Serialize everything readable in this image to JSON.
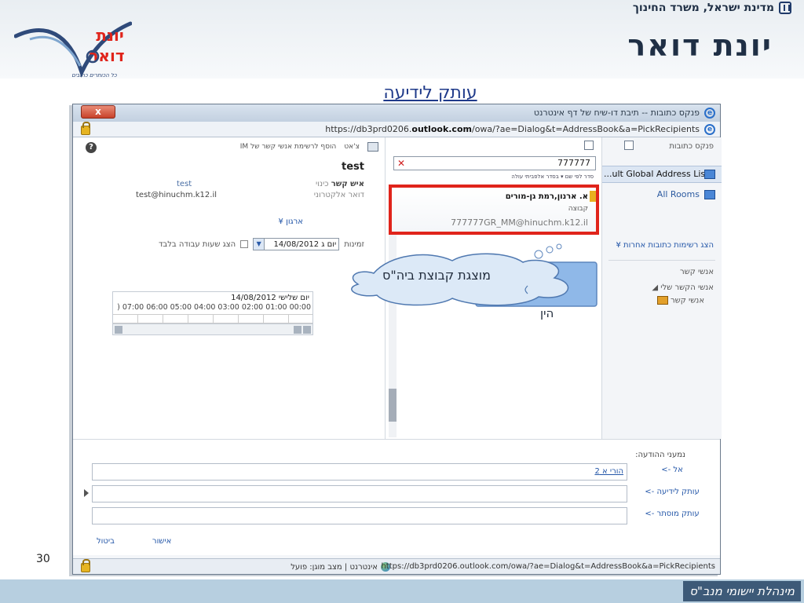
{
  "slide": {
    "ministry": "מדינת ישראל, משרד החינוך",
    "main_title": "יונת דואר",
    "logo_text_top": "יונת",
    "logo_text_bottom": "דואר",
    "logo_tagline": "כל הכותרים כתובים",
    "slide_title": "עותק לידיעה",
    "page_number": "30",
    "footer_tag": "מינהלת יישומי מנב\"ס"
  },
  "browser": {
    "close_label": "x",
    "window_title": "פנקס כתובות -- תיבת דו-שיח של דף אינטרנט",
    "address_prefix": "https://db3prd0206.",
    "address_domain": "outlook.com",
    "address_suffix": "/owa/?ae=Dialog&t=AddressBook&a=PickRecipients",
    "status_url": "https://db3prd0206.outlook.com/owa/?ae=Dialog&t=AddressBook&a=PickRecipients",
    "status_zone": "אינטרנט | מצב מוגן: פועל"
  },
  "left_pane": {
    "chat_label": "צ'אט",
    "add_to_im": "הוסף לרשימת אנשי קשר של IM",
    "contact_name": "test",
    "contact_label": "איש קשר",
    "alias_label": "כינוי",
    "alias_value": "test",
    "email_label": "דואר אלקטרוני",
    "email_value": "test@hinuchm.k12.il",
    "organization_link": "ארגון",
    "availability_label": "זמינות",
    "date_value": "יום ג 14/08/2012",
    "work_hours_only": "הצג שעות עבודה בלבד",
    "schedule_date": "יום שלישי 14/08/2012",
    "schedule_hours": ") 07:00 06:00 05:00 04:00 03:00 02:00 01:00 00:00"
  },
  "middle_pane": {
    "search_value": "777777",
    "sort_options": "סדר לפי שם  ▾  בסדר אלפביתי עולה",
    "result_name": "א. ארנון,רמת גן-מורים",
    "result_type": "קבוצה",
    "result_email": "777777GR_MM@hinuchm.k12.il"
  },
  "right_pane": {
    "title": "פנקס כתובות",
    "gal": "...ult Global Address List",
    "all_rooms": "All Rooms",
    "other_lists": "הצג רשימות כתובות אחרות",
    "contacts_section": "אנשי קשר",
    "my_contacts": "אנשי הקשר שלי",
    "contacts_item": "אנשי קשר"
  },
  "callout": {
    "text": "מוצגת קבוצת ביה\"ס",
    "back_text": "הין"
  },
  "recipients": {
    "header": "נמעני ההודעה:",
    "to_label": "אל ->",
    "to_token": "הורי א 2",
    "cc_label": "עותק לידיעה ->",
    "bcc_label": "עותק מוסתר ->",
    "ok_label": "אישור",
    "cancel_label": "ביטול"
  }
}
